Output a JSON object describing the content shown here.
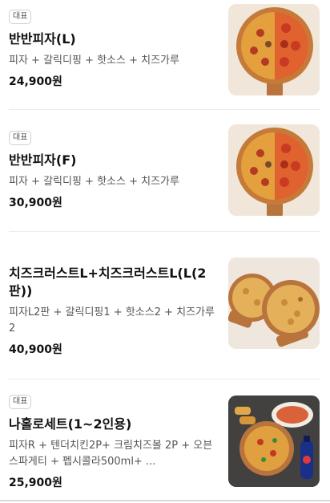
{
  "menu": {
    "items": [
      {
        "badge": "대표",
        "name": "반반피자(L)",
        "description": "피자 + 갈릭디핑 + 핫소스 + 치즈가루",
        "price": "24,900원",
        "image": "pizza-half-half"
      },
      {
        "badge": "대표",
        "name": "반반피자(F)",
        "description": "피자 + 갈릭디핑 + 핫소스 + 치즈가루",
        "price": "30,900원",
        "image": "pizza-half-half"
      },
      {
        "badge": "",
        "name": "치즈크러스트L+치즈크러스트L(L(2판))",
        "description": "피자L2판 + 갈릭디핑1 + 핫소스2 + 치즈가루 2",
        "price": "40,900원",
        "image": "two-cheese-crust-pizzas"
      },
      {
        "badge": "대표",
        "name": "나홀로세트(1~2인용)",
        "description": "피자R + 텐더치킨2P+ 크림치즈볼 2P + 오븐스파게티 + 펩시콜라500ml+ ...",
        "price": "25,900원",
        "image": "solo-set-meal"
      }
    ]
  }
}
